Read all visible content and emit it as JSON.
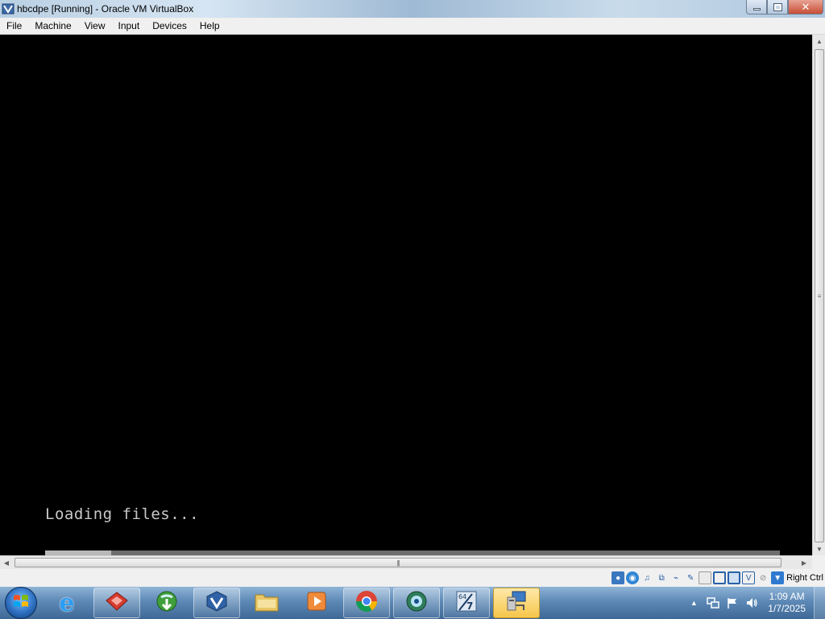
{
  "window": {
    "title": "hbcdpe [Running] - Oracle VM VirtualBox",
    "minimize_icon": "minimize-icon",
    "restore_icon": "restore-icon",
    "close_icon": "close-icon"
  },
  "menubar": {
    "items": [
      "File",
      "Machine",
      "View",
      "Input",
      "Devices",
      "Help"
    ]
  },
  "vm": {
    "console_text": "Loading files...",
    "progress": 0.09
  },
  "statusbar": {
    "icons": [
      "hard-disk-icon",
      "optical-drive-icon",
      "audio-icon",
      "network-icon",
      "usb-icon",
      "shared-folders-icon",
      "display-icon",
      "video-capture-icon",
      "virtualization-icon",
      "mouse-integration-icon",
      "keyboard-capture-icon"
    ],
    "host_key": "Right Ctrl"
  },
  "taskbar": {
    "apps": [
      "internet-explorer-icon",
      "app-red-icon",
      "download-manager-icon",
      "virtualbox-icon",
      "file-explorer-icon",
      "media-player-icon",
      "chrome-icon",
      "green-globe-icon",
      "windows7-usb-tool-icon",
      "virtualbox-machine-icon"
    ],
    "clock_time": "1:09 AM",
    "clock_date": "1/7/2025"
  }
}
